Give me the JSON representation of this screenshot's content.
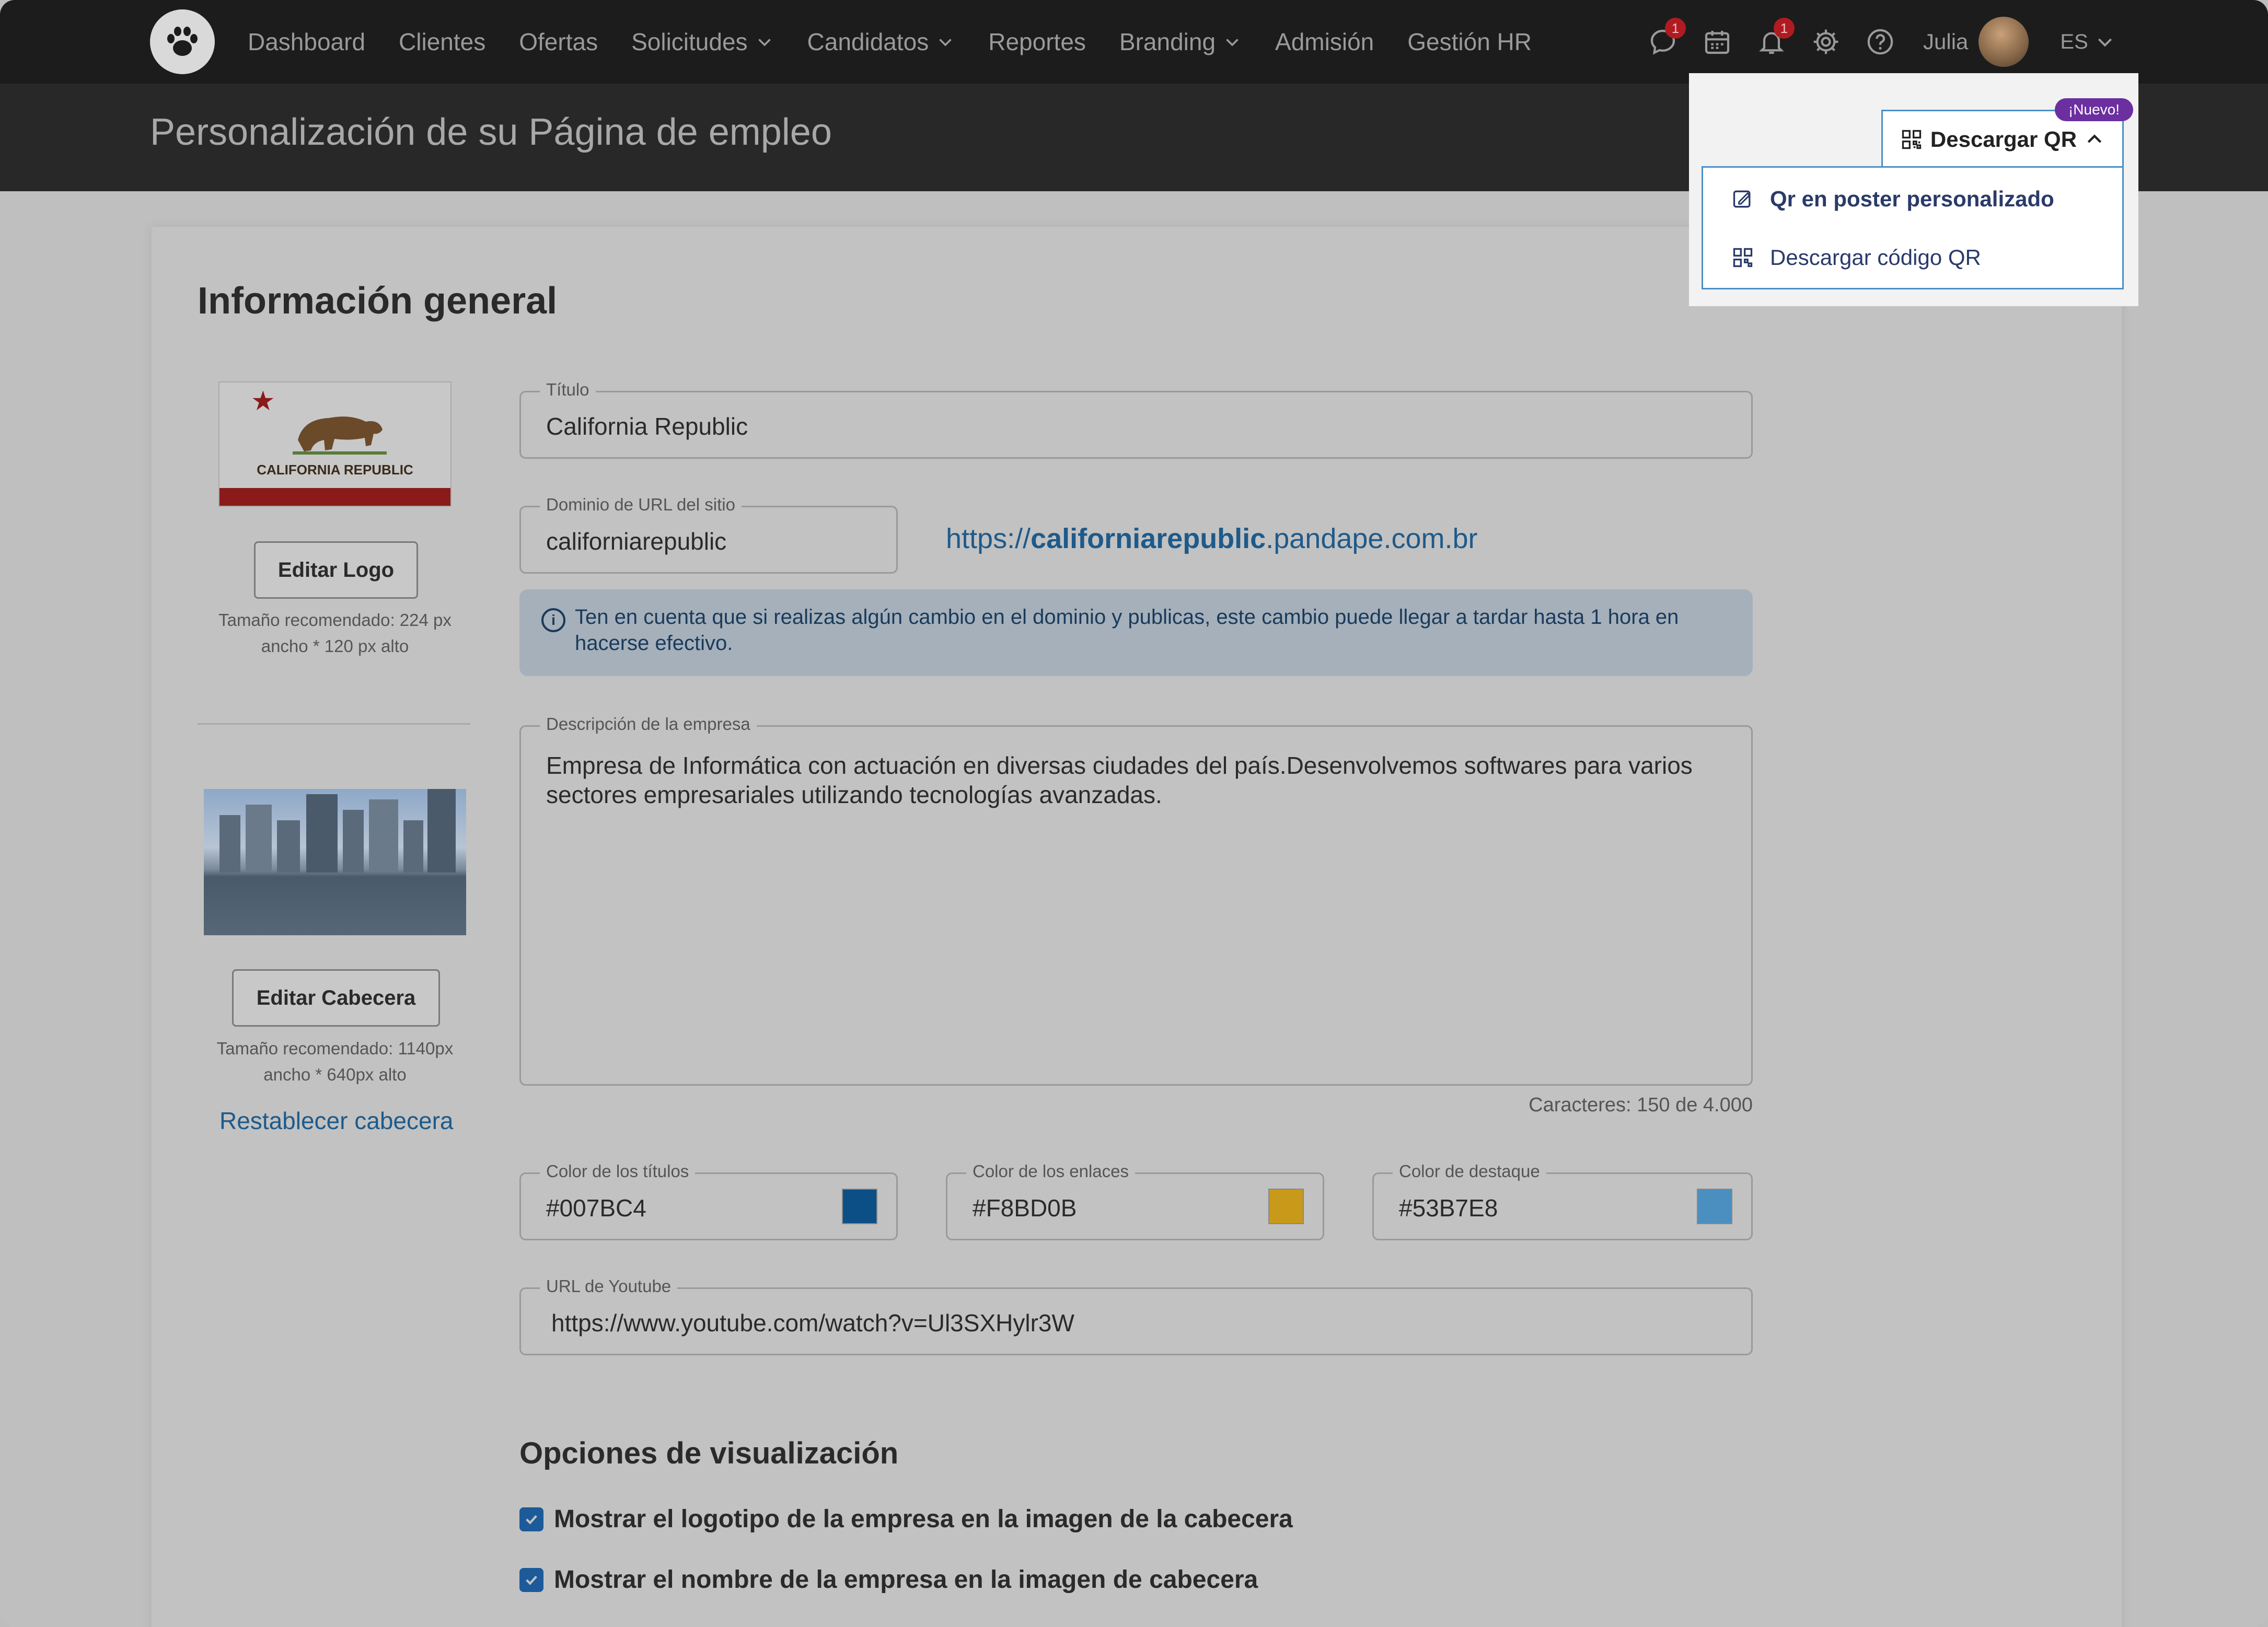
{
  "nav": {
    "items": [
      {
        "label": "Dashboard",
        "has_chevron": false
      },
      {
        "label": "Clientes",
        "has_chevron": false
      },
      {
        "label": "Ofertas",
        "has_chevron": false
      },
      {
        "label": "Solicitudes",
        "has_chevron": true
      },
      {
        "label": "Candidatos",
        "has_chevron": true
      },
      {
        "label": "Reportes",
        "has_chevron": false
      },
      {
        "label": "Branding",
        "has_chevron": true
      },
      {
        "label": "Admisión",
        "has_chevron": false
      },
      {
        "label": "Gestión HR",
        "has_chevron": false
      }
    ],
    "icons": {
      "chat_badge": "1",
      "bell_badge": "1"
    },
    "user_name": "Julia",
    "language": "ES"
  },
  "header": {
    "title": "Personalización de su Página de empleo",
    "qr_button": "Descargar QR",
    "new_badge": "¡Nuevo!",
    "dropdown": [
      {
        "label": "Qr en poster personalizado",
        "icon": "poster-icon"
      },
      {
        "label": "Descargar código QR",
        "icon": "qr-code-icon"
      }
    ]
  },
  "general": {
    "section_title": "Información general",
    "logo": {
      "flag_text": "CALIFORNIA REPUBLIC",
      "edit_button": "Editar Logo",
      "hint": "Tamaño recomendado: 224 px ancho * 120 px alto"
    },
    "header_image": {
      "edit_button": "Editar Cabecera",
      "hint": "Tamaño recomendado: 1140px ancho * 640px alto",
      "reset_link": "Restablecer cabecera"
    },
    "title_field": {
      "label": "Título",
      "value": "California Republic"
    },
    "domain_field": {
      "label": "Dominio de URL del sitio",
      "value": "californiarepublic"
    },
    "url_display": {
      "prefix": "https://",
      "domain": "californiarepublic",
      "suffix": ".pandape.com.br"
    },
    "info_note": "Ten en cuenta que si realizas algún cambio en el dominio y publicas, este cambio puede llegar a tardar hasta 1 hora en hacerse efectivo.",
    "description_field": {
      "label": "Descripción de la empresa",
      "value": "Empresa de Informática con actuación en diversas ciudades del país.Desenvolvemos softwares para varios sectores empresariales utilizando tecnologías avanzadas."
    },
    "char_count": "Caracteres: 150 de 4.000",
    "colors": [
      {
        "label": "Color de los títulos",
        "value": "#007BC4",
        "swatch": "#0b4f86"
      },
      {
        "label": "Color de los enlaces",
        "value": "#F8BD0B",
        "swatch": "#c99a1a"
      },
      {
        "label": "Color de destaque",
        "value": "#53B7E8",
        "swatch": "#4a8fbf"
      }
    ],
    "youtube_field": {
      "label": "URL de Youtube",
      "value": "https://www.youtube.com/watch?v=Ul3SXHylr3W"
    }
  },
  "display_options": {
    "title": "Opciones de visualización",
    "options": [
      {
        "label": "Mostrar el logotipo de la empresa en la imagen de la cabecera",
        "checked": true
      },
      {
        "label": "Mostrar el nombre de la empresa en la imagen de cabecera",
        "checked": true
      }
    ]
  }
}
